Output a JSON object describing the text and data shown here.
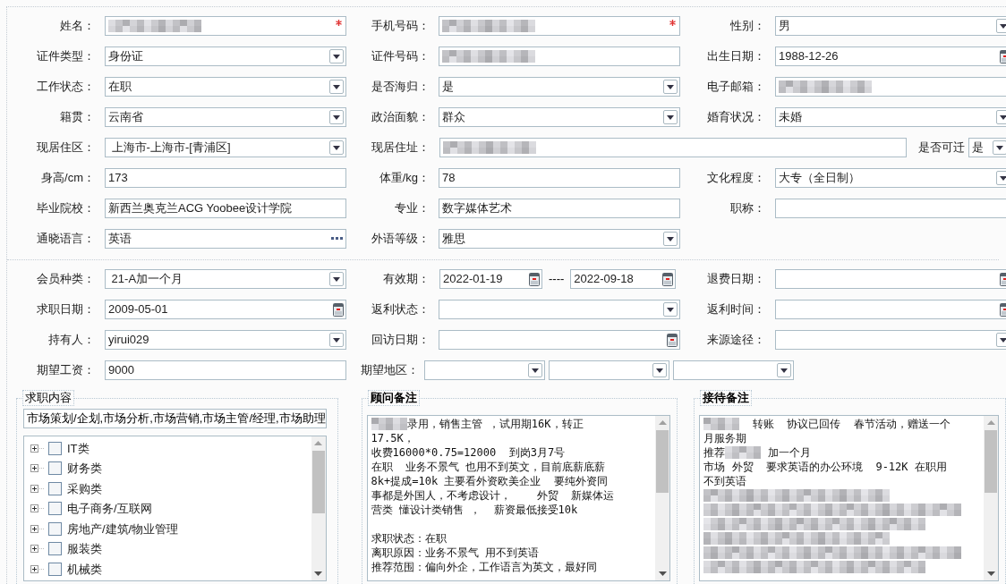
{
  "profile": {
    "rows": [
      [
        {
          "label": "姓名：",
          "kind": "text",
          "blurred": true,
          "required": true
        },
        {
          "label": "手机号码：",
          "kind": "text",
          "blurred": true,
          "required": true
        },
        {
          "label": "性别：",
          "kind": "select",
          "value": "男"
        }
      ],
      [
        {
          "label": "证件类型：",
          "kind": "select",
          "value": "身份证"
        },
        {
          "label": "证件号码：",
          "kind": "text",
          "blurred": true
        },
        {
          "label": "出生日期：",
          "kind": "date",
          "value": "1988-12-26"
        }
      ],
      [
        {
          "label": "工作状态：",
          "kind": "select",
          "value": "在职"
        },
        {
          "label": "是否海归：",
          "kind": "select",
          "value": "是"
        },
        {
          "label": "电子邮箱：",
          "kind": "text",
          "blurred": true
        }
      ],
      [
        {
          "label": "籍贯：",
          "kind": "select",
          "value": "云南省"
        },
        {
          "label": "政治面貌：",
          "kind": "select",
          "value": "群众"
        },
        {
          "label": "婚育状况：",
          "kind": "select",
          "value": "未婚"
        }
      ],
      [
        {
          "label": "现居住区：",
          "kind": "select",
          "value": " 上海市-上海市-[青浦区]"
        },
        {
          "label": "现居住址：",
          "kind": "wide_text",
          "blurred": true
        },
        {
          "label": "是否可迁",
          "kind": "compact_select",
          "value": "是"
        }
      ],
      [
        {
          "label": "身高/cm：",
          "kind": "text",
          "value": "173"
        },
        {
          "label": "体重/kg：",
          "kind": "text",
          "value": "78"
        },
        {
          "label": "文化程度：",
          "kind": "select",
          "value": "大专（全日制）"
        }
      ],
      [
        {
          "label": "毕业院校：",
          "kind": "text",
          "value": "新西兰奥克兰ACG Yoobee设计学院"
        },
        {
          "label": "专业：",
          "kind": "text",
          "value": "数字媒体艺术"
        },
        {
          "label": "职称：",
          "kind": "text"
        }
      ],
      [
        {
          "label": "通晓语言：",
          "kind": "picker",
          "value": "英语"
        },
        {
          "label": "外语等级：",
          "kind": "select",
          "value": "雅思"
        }
      ]
    ]
  },
  "membership": {
    "rows": [
      [
        {
          "label": "会员种类：",
          "kind": "select",
          "value": " 21-A加一个月"
        },
        {
          "label": "有效期：",
          "kind": "date_range",
          "values": [
            "2022-01-19",
            "2022-09-18"
          ],
          "separator": "----"
        },
        {
          "label": "退费日期：",
          "kind": "date"
        }
      ],
      [
        {
          "label": "求职日期：",
          "kind": "date",
          "value": "2009-05-01"
        },
        {
          "label": "返利状态：",
          "kind": "select"
        },
        {
          "label": "返利时间：",
          "kind": "date"
        }
      ],
      [
        {
          "label": "持有人：",
          "kind": "select",
          "value": "yirui029"
        },
        {
          "label": "回访日期：",
          "kind": "date"
        },
        {
          "label": "来源途径：",
          "kind": "select"
        }
      ],
      [
        {
          "label": "期望工资：",
          "kind": "text",
          "value": "9000"
        },
        {
          "label": "期望地区：",
          "kind": "select_triple"
        }
      ]
    ]
  },
  "job_intent": {
    "title": "求职内容",
    "summary": "市场策划/企划,市场分析,市场营销,市场主管/经理,市场助理",
    "categories": [
      {
        "label": "IT类",
        "checked": false,
        "expanded": false
      },
      {
        "label": "财务类",
        "checked": false,
        "expanded": false
      },
      {
        "label": "采购类",
        "checked": false,
        "expanded": false
      },
      {
        "label": "电子商务/互联网",
        "checked": false,
        "expanded": false
      },
      {
        "label": "房地产/建筑/物业管理",
        "checked": false,
        "expanded": false
      },
      {
        "label": "服装类",
        "checked": false,
        "expanded": false
      },
      {
        "label": "机械类",
        "checked": false,
        "expanded": false
      }
    ]
  },
  "notes": [
    {
      "title": "顾问备注",
      "lines": [
        {
          "parts": [
            {
              "kind": "blur"
            },
            {
              "kind": "text",
              "text": "录用，销售主管 ，试用期16K，转正"
            }
          ]
        },
        {
          "parts": [
            {
              "kind": "text",
              "text": "17.5K，"
            }
          ]
        },
        {
          "parts": [
            {
              "kind": "text",
              "text": "收费16000*0.75=12000  到岗3月7号"
            }
          ]
        },
        {
          "parts": [
            {
              "kind": "text",
              "text": "在职  业务不景气 也用不到英文，目前底薪底薪"
            }
          ]
        },
        {
          "parts": [
            {
              "kind": "text",
              "text": "8k+提成=10k 主要看外资欧美企业  要纯外资同"
            }
          ]
        },
        {
          "parts": [
            {
              "kind": "text",
              "text": "事都是外国人，不考虑设计，    外贸  新媒体运"
            }
          ]
        },
        {
          "parts": [
            {
              "kind": "text",
              "text": "营类 懂设计类销售 ，  薪资最低接受10k"
            }
          ]
        },
        {
          "gap_before": true,
          "parts": [
            {
              "kind": "text",
              "text": "求职状态：在职"
            }
          ]
        },
        {
          "parts": [
            {
              "kind": "text",
              "text": "离职原因：业务不景气 用不到英语"
            }
          ]
        },
        {
          "parts": [
            {
              "kind": "text",
              "text": "推荐范围：偏向外企，工作语言为英文，最好同"
            }
          ]
        }
      ]
    },
    {
      "title": "接待备注",
      "lines": [
        {
          "parts": [
            {
              "kind": "blur"
            },
            {
              "kind": "text",
              "text": "  转账  协议已回传  春节活动，赠送一个"
            }
          ]
        },
        {
          "parts": [
            {
              "kind": "text",
              "text": "月服务期"
            }
          ]
        },
        {
          "parts": [
            {
              "kind": "text",
              "text": "推荐"
            },
            {
              "kind": "blur"
            },
            {
              "kind": "text",
              "text": " 加一个月"
            }
          ]
        },
        {
          "parts": [
            {
              "kind": "text",
              "text": "市场 外贸  要求英语的办公环境  9-12K 在职用"
            }
          ]
        },
        {
          "parts": [
            {
              "kind": "text",
              "text": "不到英语"
            }
          ]
        },
        {
          "parts": [
            {
              "kind": "blur_line"
            }
          ]
        },
        {
          "parts": [
            {
              "kind": "blur_line"
            }
          ]
        },
        {
          "parts": [
            {
              "kind": "blur_line"
            }
          ]
        },
        {
          "parts": [
            {
              "kind": "blur_line"
            }
          ]
        },
        {
          "parts": [
            {
              "kind": "blur_line"
            }
          ]
        },
        {
          "parts": [
            {
              "kind": "blur_line"
            }
          ]
        }
      ]
    }
  ]
}
